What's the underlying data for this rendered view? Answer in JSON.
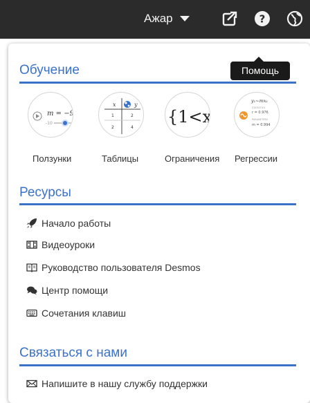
{
  "topbar": {
    "user_label": "Ажар",
    "icons": [
      "share-icon",
      "help-icon",
      "globe-icon"
    ]
  },
  "tooltip": "Помощь",
  "help_menu": {
    "learning": {
      "title": "Обучение",
      "tiles": [
        {
          "label": "Ползунки",
          "art": {
            "eq": "m = −9",
            "min": "-10"
          }
        },
        {
          "label": "Таблицы",
          "art": {
            "head_x": "x",
            "head_y": "y",
            "r1": "1",
            "r1y": "2",
            "r2": "2",
            "r2y": "4"
          }
        },
        {
          "label": "Ограничения",
          "art": {
            "expr": "{1<x"
          }
        },
        {
          "label": "Регрессии",
          "art": {
            "eq": "y₁~mx₁",
            "s1": "STATISTICS",
            "r": "r = 0.976",
            "s2": "PARAMETERS",
            "m": "m = 0.994"
          }
        }
      ]
    },
    "resources": {
      "title": "Ресурсы",
      "links": [
        {
          "label": "Начало работы",
          "icon": "rocket-icon"
        },
        {
          "label": "Видеоуроки",
          "icon": "film-icon"
        },
        {
          "label": "Руководство пользователя Desmos",
          "icon": "book-icon"
        },
        {
          "label": "Центр помощи",
          "icon": "chat-icon"
        },
        {
          "label": "Сочетания клавиш",
          "icon": "keyboard-icon"
        }
      ]
    },
    "contact": {
      "title": "Связаться с нами",
      "links": [
        {
          "label": "Напишите в нашу службу поддержки",
          "icon": "envelope-icon"
        }
      ]
    }
  },
  "colors": {
    "accent": "#3a72c9",
    "topbar": "#2b2b2b",
    "slider_dot": "#3a72c9",
    "regression_orange": "#f0962e"
  }
}
